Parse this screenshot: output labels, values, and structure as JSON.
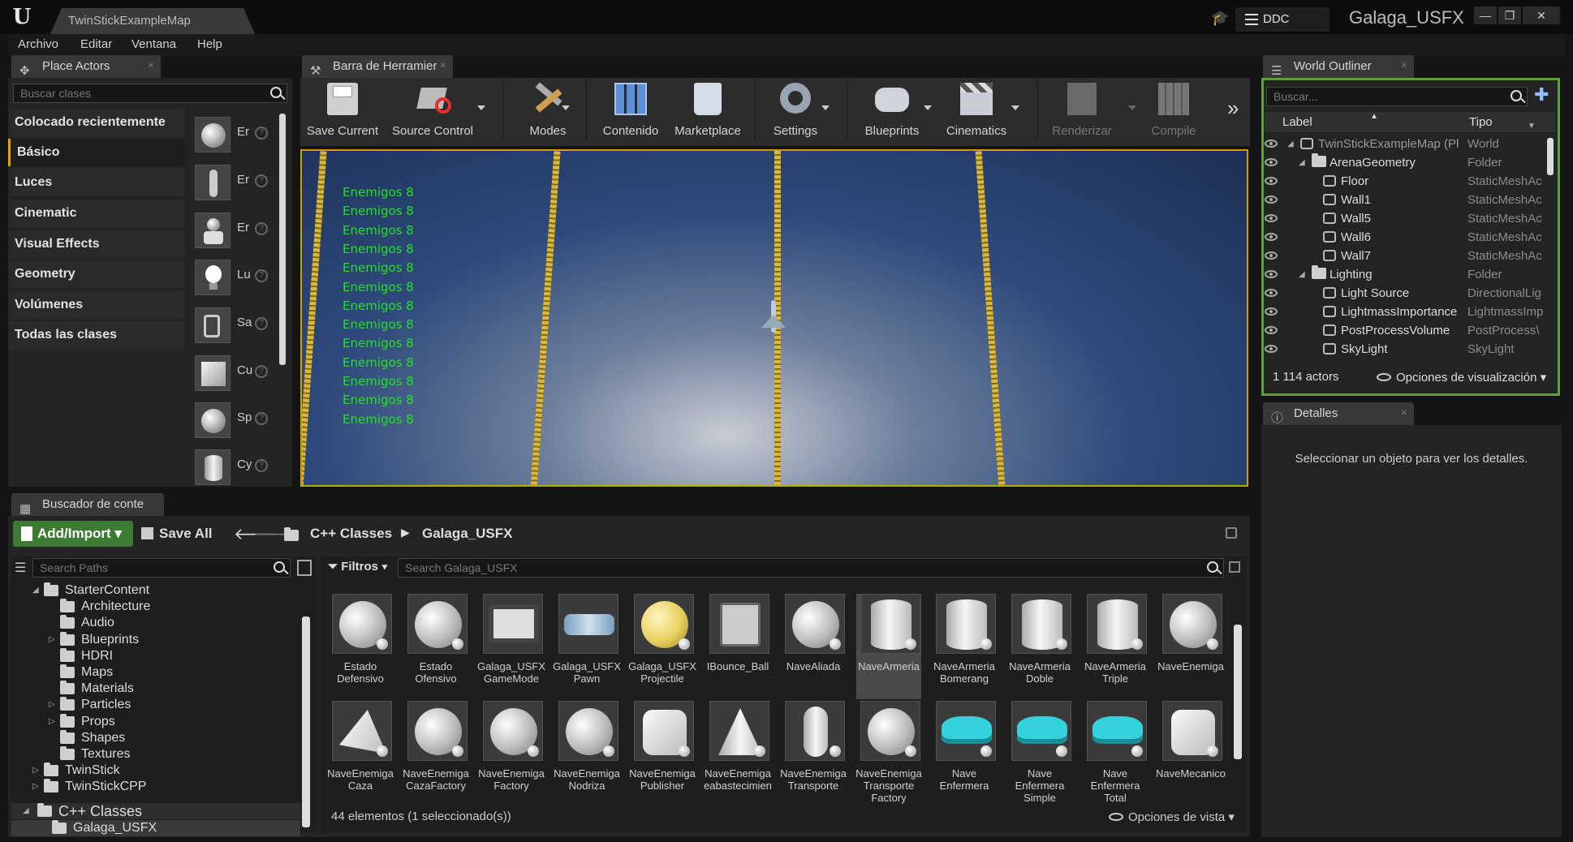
{
  "window": {
    "logo": "U",
    "doc_tab": "TwinStickExampleMap",
    "ddc": "DDC",
    "project": "Galaga_USFX",
    "buttons": {
      "minimize": "—",
      "restore": "❐",
      "close": "✕"
    }
  },
  "menu": [
    "Archivo",
    "Editar",
    "Ventana",
    "Help"
  ],
  "place_actors": {
    "tab": "Place Actors",
    "search_placeholder": "Buscar clases",
    "categories": [
      "Colocado recientemente",
      "Básico",
      "Luces",
      "Cinematic",
      "Visual Effects",
      "Geometry",
      "Volúmenes",
      "Todas las clases"
    ],
    "selected_category": "Básico",
    "actors": [
      {
        "label": "Er",
        "icon": "sphere-icon"
      },
      {
        "label": "Er",
        "icon": "character-icon"
      },
      {
        "label": "Er",
        "icon": "pawn-icon"
      },
      {
        "label": "Lu",
        "icon": "light-bulb-icon"
      },
      {
        "label": "Sa",
        "icon": "player-start-icon"
      },
      {
        "label": "Cu",
        "icon": "cube-icon"
      },
      {
        "label": "Sp",
        "icon": "sphere-icon"
      },
      {
        "label": "Cy",
        "icon": "cylinder-icon"
      }
    ]
  },
  "toolbar": {
    "tab": "Barra de Herramier",
    "buttons": [
      {
        "label": "Save Current",
        "icon": "save-icon"
      },
      {
        "label": "Source Control",
        "icon": "source-control-icon"
      },
      {
        "label": "Modes",
        "icon": "modes-icon"
      },
      {
        "label": "Contenido",
        "icon": "content-icon"
      },
      {
        "label": "Marketplace",
        "icon": "marketplace-icon"
      },
      {
        "label": "Settings",
        "icon": "settings-icon"
      },
      {
        "label": "Blueprints",
        "icon": "blueprints-icon"
      },
      {
        "label": "Cinematics",
        "icon": "cinematics-icon"
      },
      {
        "label": "Renderizar",
        "icon": "build-icon"
      },
      {
        "label": "Compile",
        "icon": "compile-icon"
      }
    ],
    "more": "»"
  },
  "viewport": {
    "hud_lines": [
      "Enemigos 8",
      "Enemigos 8",
      "Enemigos 8",
      "Enemigos 8",
      "Enemigos 8",
      "Enemigos 8",
      "Enemigos 8",
      "Enemigos 8",
      "Enemigos 8",
      "Enemigos 8",
      "Enemigos 8",
      "Enemigos 8",
      "Enemigos 8"
    ],
    "hud_color": "#23e023"
  },
  "outliner": {
    "tab": "World Outliner",
    "search_placeholder": "Buscar...",
    "col_label": "Label",
    "col_type": "Tipo",
    "rows": [
      {
        "name": "TwinStickExampleMap (Pl",
        "type": "World"
      },
      {
        "name": "ArenaGeometry",
        "type": "Folder"
      },
      {
        "name": "Floor",
        "type": "StaticMeshAc"
      },
      {
        "name": "Wall1",
        "type": "StaticMeshAc"
      },
      {
        "name": "Wall5",
        "type": "StaticMeshAc"
      },
      {
        "name": "Wall6",
        "type": "StaticMeshAc"
      },
      {
        "name": "Wall7",
        "type": "StaticMeshAc"
      },
      {
        "name": "Lighting",
        "type": "Folder"
      },
      {
        "name": "Light Source",
        "type": "DirectionalLig"
      },
      {
        "name": "LightmassImportance",
        "type": "LightmassImp"
      },
      {
        "name": "PostProcessVolume",
        "type": "PostProcess\\"
      },
      {
        "name": "SkyLight",
        "type": "SkyLight"
      }
    ],
    "count": "1 114 actors",
    "view_options": "Opciones de visualización"
  },
  "details": {
    "tab": "Detalles",
    "empty": "Seleccionar un objeto para ver los detalles."
  },
  "content_browser": {
    "tab": "Buscador de conte",
    "add_import": "Add/Import",
    "save_all": "Save All",
    "crumbs": [
      "C++ Classes",
      "Galaga_USFX"
    ],
    "paths_placeholder": "Search Paths",
    "filters": "Filtros",
    "search_placeholder": "Search Galaga_USFX",
    "tree": [
      {
        "name": "StarterContent",
        "indent": 1
      },
      {
        "name": "Architecture",
        "indent": 2
      },
      {
        "name": "Audio",
        "indent": 2
      },
      {
        "name": "Blueprints",
        "indent": 2
      },
      {
        "name": "HDRI",
        "indent": 2
      },
      {
        "name": "Maps",
        "indent": 2
      },
      {
        "name": "Materials",
        "indent": 2
      },
      {
        "name": "Particles",
        "indent": 2
      },
      {
        "name": "Props",
        "indent": 2
      },
      {
        "name": "Shapes",
        "indent": 2
      },
      {
        "name": "Textures",
        "indent": 2
      },
      {
        "name": "TwinStick",
        "indent": 1
      },
      {
        "name": "TwinStickCPP",
        "indent": 1
      },
      {
        "name": "C++ Classes",
        "indent": 0
      },
      {
        "name": "Galaga_USFX",
        "indent": 1
      }
    ],
    "assets": [
      {
        "name": "Estado\nDefensivo",
        "shape": "sphere"
      },
      {
        "name": "Estado\nOfensivo",
        "shape": "sphere"
      },
      {
        "name": "Galaga_USFX\nGameMode",
        "shape": "gamepad"
      },
      {
        "name": "Galaga_USFX\nPawn",
        "shape": "pawn"
      },
      {
        "name": "Galaga_USFX\nProjectile",
        "shape": "yellow-sphere"
      },
      {
        "name": "IBounce_Ball",
        "shape": "interface"
      },
      {
        "name": "NaveAliada",
        "shape": "sphere"
      },
      {
        "name": "NaveArmeria",
        "shape": "cylinder"
      },
      {
        "name": "NaveArmeria\nBomerang",
        "shape": "cylinder"
      },
      {
        "name": "NaveArmeria\nDoble",
        "shape": "cylinder"
      },
      {
        "name": "NaveArmeria\nTriple",
        "shape": "cylinder"
      },
      {
        "name": "NaveEnemiga",
        "shape": "sphere"
      },
      {
        "name": "NaveEnemiga\nCaza",
        "shape": "cone-flat"
      },
      {
        "name": "NaveEnemiga\nCazaFactory",
        "shape": "sphere"
      },
      {
        "name": "NaveEnemiga\nFactory",
        "shape": "sphere"
      },
      {
        "name": "NaveEnemiga\nNodriza",
        "shape": "sphere"
      },
      {
        "name": "NaveEnemiga\nPublisher",
        "shape": "rounded-cube"
      },
      {
        "name": "NaveEnemiga\neabastecimien",
        "shape": "cone"
      },
      {
        "name": "NaveEnemiga\nTransporte",
        "shape": "capsule"
      },
      {
        "name": "NaveEnemiga\nTransporte\nFactory",
        "shape": "sphere"
      },
      {
        "name": "Nave\nEnfermera",
        "shape": "ship"
      },
      {
        "name": "Nave\nEnfermera\nSimple",
        "shape": "ship"
      },
      {
        "name": "Nave\nEnfermera\nTotal",
        "shape": "ship"
      },
      {
        "name": "NaveMecanico",
        "shape": "rounded-cube"
      }
    ],
    "selected_asset": "NaveArmeria",
    "status": "44 elementos (1 seleccionado(s))",
    "view_options": "Opciones de vista"
  },
  "colors": {
    "accent": "#e2a400",
    "add_button": "#3d7a34",
    "selected_panel": "#5fa03a"
  }
}
